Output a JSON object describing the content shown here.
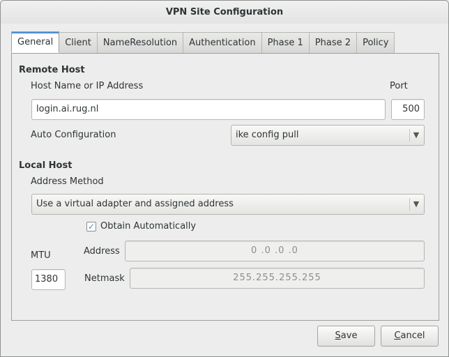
{
  "window": {
    "title": "VPN Site Configuration"
  },
  "tabs": [
    {
      "label": "General",
      "active": true
    },
    {
      "label": "Client",
      "active": false
    },
    {
      "label": "NameResolution",
      "active": false
    },
    {
      "label": "Authentication",
      "active": false
    },
    {
      "label": "Phase 1",
      "active": false
    },
    {
      "label": "Phase 2",
      "active": false
    },
    {
      "label": "Policy",
      "active": false
    }
  ],
  "remote_host": {
    "section_label": "Remote Host",
    "host_label": "Host Name or IP Address",
    "host_value": "login.ai.rug.nl",
    "port_label": "Port",
    "port_value": "500",
    "auto_config_label": "Auto Configuration",
    "auto_config_value": "ike config pull"
  },
  "local_host": {
    "section_label": "Local Host",
    "address_method_label": "Address Method",
    "address_method_value": "Use a virtual adapter and assigned address",
    "obtain_auto_label": "Obtain Automatically",
    "obtain_auto_checked": true,
    "mtu_label": "MTU",
    "mtu_value": "1380",
    "address_label": "Address",
    "address_value": "0 .0 .0 .0",
    "netmask_label": "Netmask",
    "netmask_value": "255.255.255.255"
  },
  "buttons": {
    "save_mnemonic": "S",
    "save_rest": "ave",
    "cancel_mnemonic": "C",
    "cancel_rest": "ancel"
  },
  "colors": {
    "accent": "#4a90d9",
    "window_bg": "#ededed"
  }
}
